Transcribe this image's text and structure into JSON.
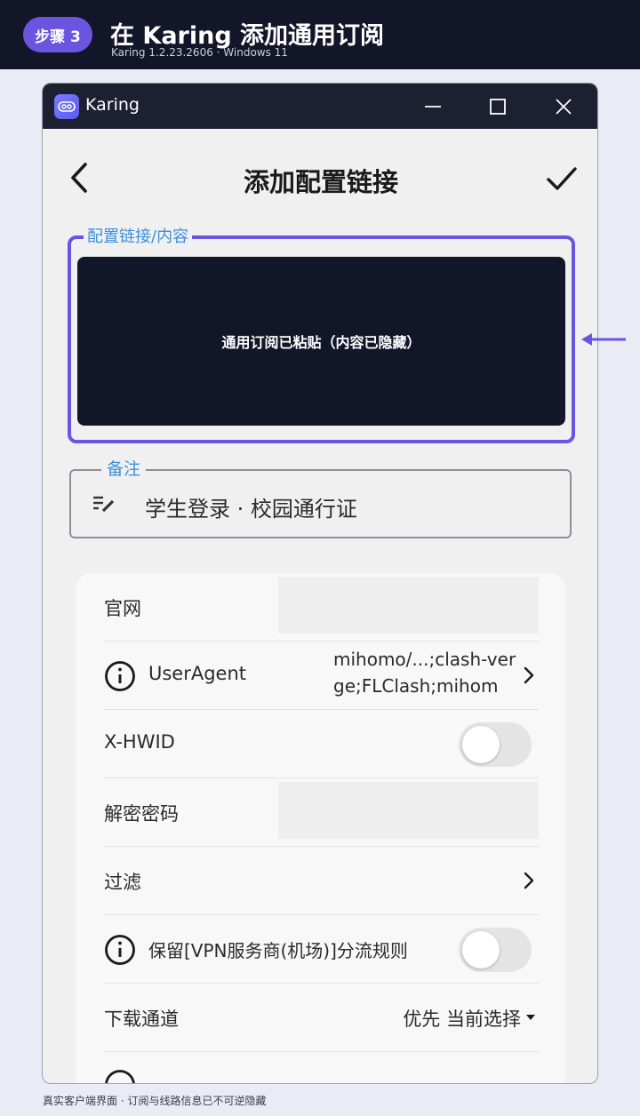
{
  "banner": {
    "step": "步骤 3",
    "title": "在 Karing 添加通用订阅",
    "subtitle": "Karing 1.2.23.2606 · Windows 11"
  },
  "window": {
    "app_name": "Karing"
  },
  "page": {
    "title": "添加配置链接"
  },
  "link_field": {
    "label": "配置链接/内容",
    "content": "通用订阅已粘贴（内容已隐藏）"
  },
  "note_field": {
    "label": "备注",
    "value": "学生登录 · 校园通行证"
  },
  "settings": {
    "website_label": "官网",
    "useragent_label": "UserAgent",
    "useragent_value": "mihomo/...;clash-verge;FLClash;mihom",
    "xhwid_label": "X-HWID",
    "xhwid_on": false,
    "decrypt_label": "解密密码",
    "filter_label": "过滤",
    "keep_rules_label": "保留[VPN服务商(机场)]分流规则",
    "keep_rules_on": false,
    "download_label": "下载通道",
    "download_value": "优先 当前选择"
  },
  "footer": {
    "text": "真实客户端界面 · 订阅与线路信息已不可逆隐藏"
  },
  "colors": {
    "accent": "#6a55e3",
    "label_blue": "#3d8fdc",
    "dark": "#121628"
  }
}
